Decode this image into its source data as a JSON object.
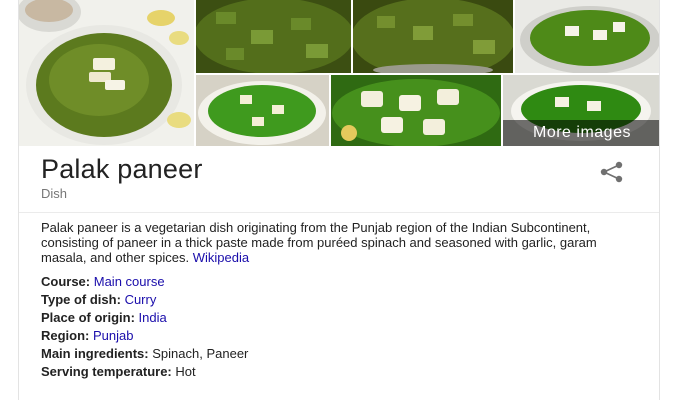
{
  "gallery": {
    "more_images_label": "More images"
  },
  "entity": {
    "title": "Palak paneer",
    "subtitle": "Dish"
  },
  "description": {
    "text": "Palak paneer is a vegetarian dish originating from the Punjab region of the Indian Subcontinent, consisting of paneer in a thick paste made from puréed spinach and seasoned with garlic, garam masala, and other spices. ",
    "source_label": "Wikipedia"
  },
  "facts": [
    {
      "label": "Course:",
      "value": "Main course",
      "is_link": true
    },
    {
      "label": "Type of dish:",
      "value": "Curry",
      "is_link": true
    },
    {
      "label": "Place of origin:",
      "value": "India",
      "is_link": true
    },
    {
      "label": "Region:",
      "value": "Punjab",
      "is_link": true
    },
    {
      "label": "Main ingredients:",
      "value": "Spinach, Paneer",
      "is_link": false
    },
    {
      "label": "Serving temperature:",
      "value": "Hot",
      "is_link": false
    }
  ],
  "colors": {
    "link": "#1a0dab",
    "text": "#222222",
    "muted": "#777777",
    "spinach_green": "#5f7a22"
  },
  "icons": {
    "share": "share-icon"
  }
}
